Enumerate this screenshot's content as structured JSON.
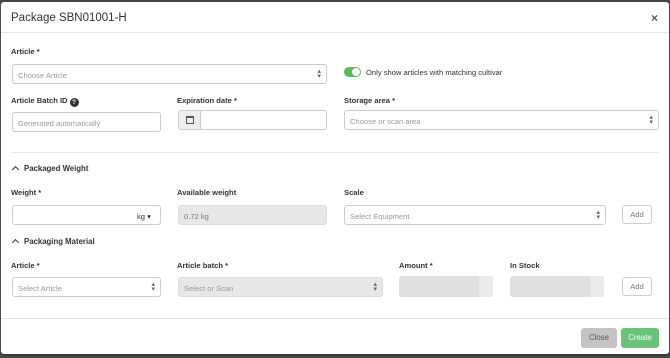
{
  "modal": {
    "title": "Package SBN01001-H",
    "close_glyph": "×"
  },
  "article": {
    "label": "Article *",
    "placeholder": "Choose Article",
    "toggle_label": "Only show articles with matching cultivar",
    "toggle_on": true
  },
  "batch": {
    "label": "Article Batch ID",
    "help_glyph": "?",
    "placeholder": "Generated automatically"
  },
  "expiration": {
    "label": "Expiration date *",
    "value": ""
  },
  "storage": {
    "label": "Storage area *",
    "placeholder": "Choose or scan area"
  },
  "packaged_weight": {
    "section_title": "Packaged Weight",
    "weight_label": "Weight *",
    "weight_value": "",
    "unit": "kg ▾",
    "available_label": "Available weight",
    "available_value": "0.72 kg",
    "scale_label": "Scale",
    "scale_placeholder": "Select Equipment",
    "add_label": "Add"
  },
  "packaging_material": {
    "section_title": "Packaging Material",
    "article_label": "Article *",
    "article_placeholder": "Select Article",
    "batch_label": "Article batch *",
    "batch_placeholder": "Select or Scan",
    "amount_label": "Amount *",
    "stock_label": "In Stock",
    "add_label": "Add"
  },
  "footer": {
    "close_label": "Close",
    "create_label": "Create"
  },
  "colors": {
    "accent_green": "#6ac27c",
    "toggle_green": "#5cb85c"
  }
}
